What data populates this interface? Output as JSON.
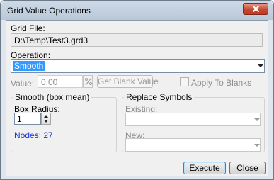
{
  "window": {
    "title": "Grid Value Operations"
  },
  "grid_file": {
    "label": "Grid File:",
    "path": "D:\\Temp\\Test3.grd3"
  },
  "operation": {
    "label": "Operation:",
    "selected": "Smooth"
  },
  "value_row": {
    "value_label": "Value:",
    "value": "0.00",
    "get_blank_label": "Get Blank Value",
    "apply_to_blanks_label": "Apply To Blanks"
  },
  "smooth_group": {
    "title": "Smooth (box mean)",
    "box_radius_label": "Box Radius:",
    "box_radius_value": "1",
    "nodes_text": "Nodes: 27"
  },
  "replace_group": {
    "title": "Replace Symbols",
    "existing_label": "Existing:",
    "new_label": "New:"
  },
  "buttons": {
    "execute": "Execute",
    "close": "Close"
  },
  "colors": {
    "selection": "#3399ff",
    "nodes_text": "#1a34d6",
    "close_button": "#c7482f"
  }
}
